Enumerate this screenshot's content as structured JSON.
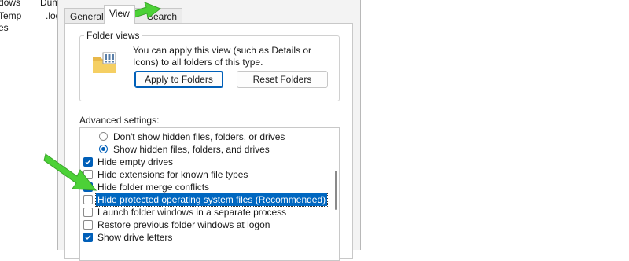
{
  "background": {
    "col1": [
      "dows",
      "Temp",
      "es"
    ],
    "col2": [
      "Dum",
      ".log"
    ]
  },
  "dialog": {
    "tabs": [
      {
        "label": "General"
      },
      {
        "label": "View"
      },
      {
        "label": "Search"
      }
    ],
    "active_tab": "View",
    "folder_views": {
      "legend": "Folder views",
      "description": "You can apply this view (such as Details or Icons) to all folders of this type.",
      "apply_button": "Apply to Folders",
      "reset_button": "Reset Folders"
    },
    "advanced": {
      "label": "Advanced settings:",
      "items": [
        {
          "type": "radio",
          "checked": false,
          "label": "Don't show hidden files, folders, or drives"
        },
        {
          "type": "radio",
          "checked": true,
          "label": "Show hidden files, folders, and drives"
        },
        {
          "type": "checkbox",
          "checked": true,
          "label": "Hide empty drives"
        },
        {
          "type": "checkbox",
          "checked": false,
          "label": "Hide extensions for known file types"
        },
        {
          "type": "checkbox",
          "checked": true,
          "label": "Hide folder merge conflicts"
        },
        {
          "type": "checkbox",
          "checked": false,
          "selected": true,
          "label": "Hide protected operating system files (Recommended)"
        },
        {
          "type": "checkbox",
          "checked": false,
          "label": "Launch folder windows in a separate process"
        },
        {
          "type": "checkbox",
          "checked": false,
          "label": "Restore previous folder windows at logon"
        },
        {
          "type": "checkbox",
          "checked": true,
          "label": "Show drive letters"
        }
      ]
    }
  },
  "colors": {
    "accent": "#005fb8",
    "selection": "#0067c0",
    "annotation_arrow": "#4cd137"
  }
}
